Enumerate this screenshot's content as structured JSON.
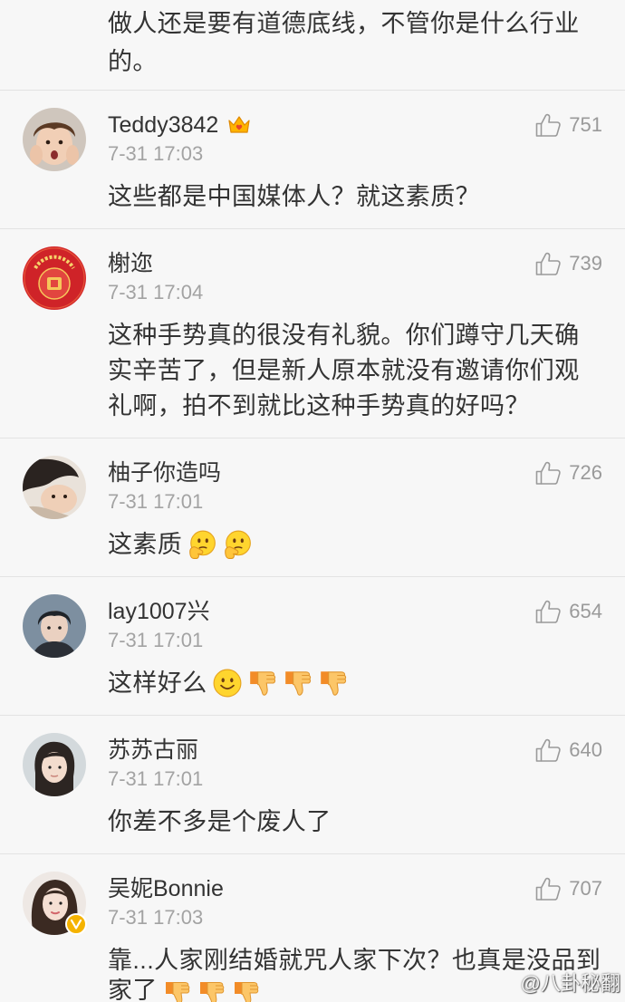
{
  "colors": {
    "background": "#f7f7f7",
    "text": "#333333",
    "meta": "#a3a3a3",
    "divider": "#e3e3e3",
    "verified": "#f5b300",
    "member_badge": "#ffb400"
  },
  "icons": {
    "like": "thumbs-up-icon",
    "member_badge": "crown-badge-icon",
    "verified": "verified-badge-icon"
  },
  "top_comment": {
    "text_lines": [
      "做人还是要有道德底线，不管你是什么行业",
      "的。"
    ]
  },
  "comments": [
    {
      "name": "Teddy3842",
      "badge": "crown-badge",
      "date": "7-31 17:03",
      "likes": "751",
      "text_lines": [
        "这些都是中国媒体人？就这素质？"
      ],
      "emojis": []
    },
    {
      "name": "榭迩",
      "date": "7-31 17:04",
      "likes": "739",
      "text_lines": [
        "这种手势真的很没有礼貌。你们蹲守几天确",
        "实辛苦了，但是新人原本就没有邀请你们观",
        "礼啊，拍不到就比这种手势真的好吗？"
      ],
      "emojis": []
    },
    {
      "name": "柚子你造吗",
      "date": "7-31 17:01",
      "likes": "726",
      "text_lines": [
        "这素质"
      ],
      "emojis": [
        "thinking-face",
        "thinking-face"
      ]
    },
    {
      "name": "lay1007兴",
      "date": "7-31 17:01",
      "likes": "654",
      "text_lines": [
        "这样好么"
      ],
      "emojis": [
        "smiling-face",
        "thumbs-down",
        "thumbs-down",
        "thumbs-down"
      ]
    },
    {
      "name": "苏苏古丽",
      "date": "7-31 17:01",
      "likes": "640",
      "text_lines": [
        "你差不多是个废人了"
      ],
      "emojis": []
    },
    {
      "name": "吴妮Bonnie",
      "verified": true,
      "date": "7-31 17:03",
      "likes": "707",
      "text_lines": [
        "靠...人家刚结婚就咒人家下次？也真是没品到",
        "家了"
      ],
      "emojis": [
        "thumbs-down",
        "thumbs-down",
        "thumbs-down"
      ]
    }
  ],
  "watermark": "@八卦秘翻"
}
